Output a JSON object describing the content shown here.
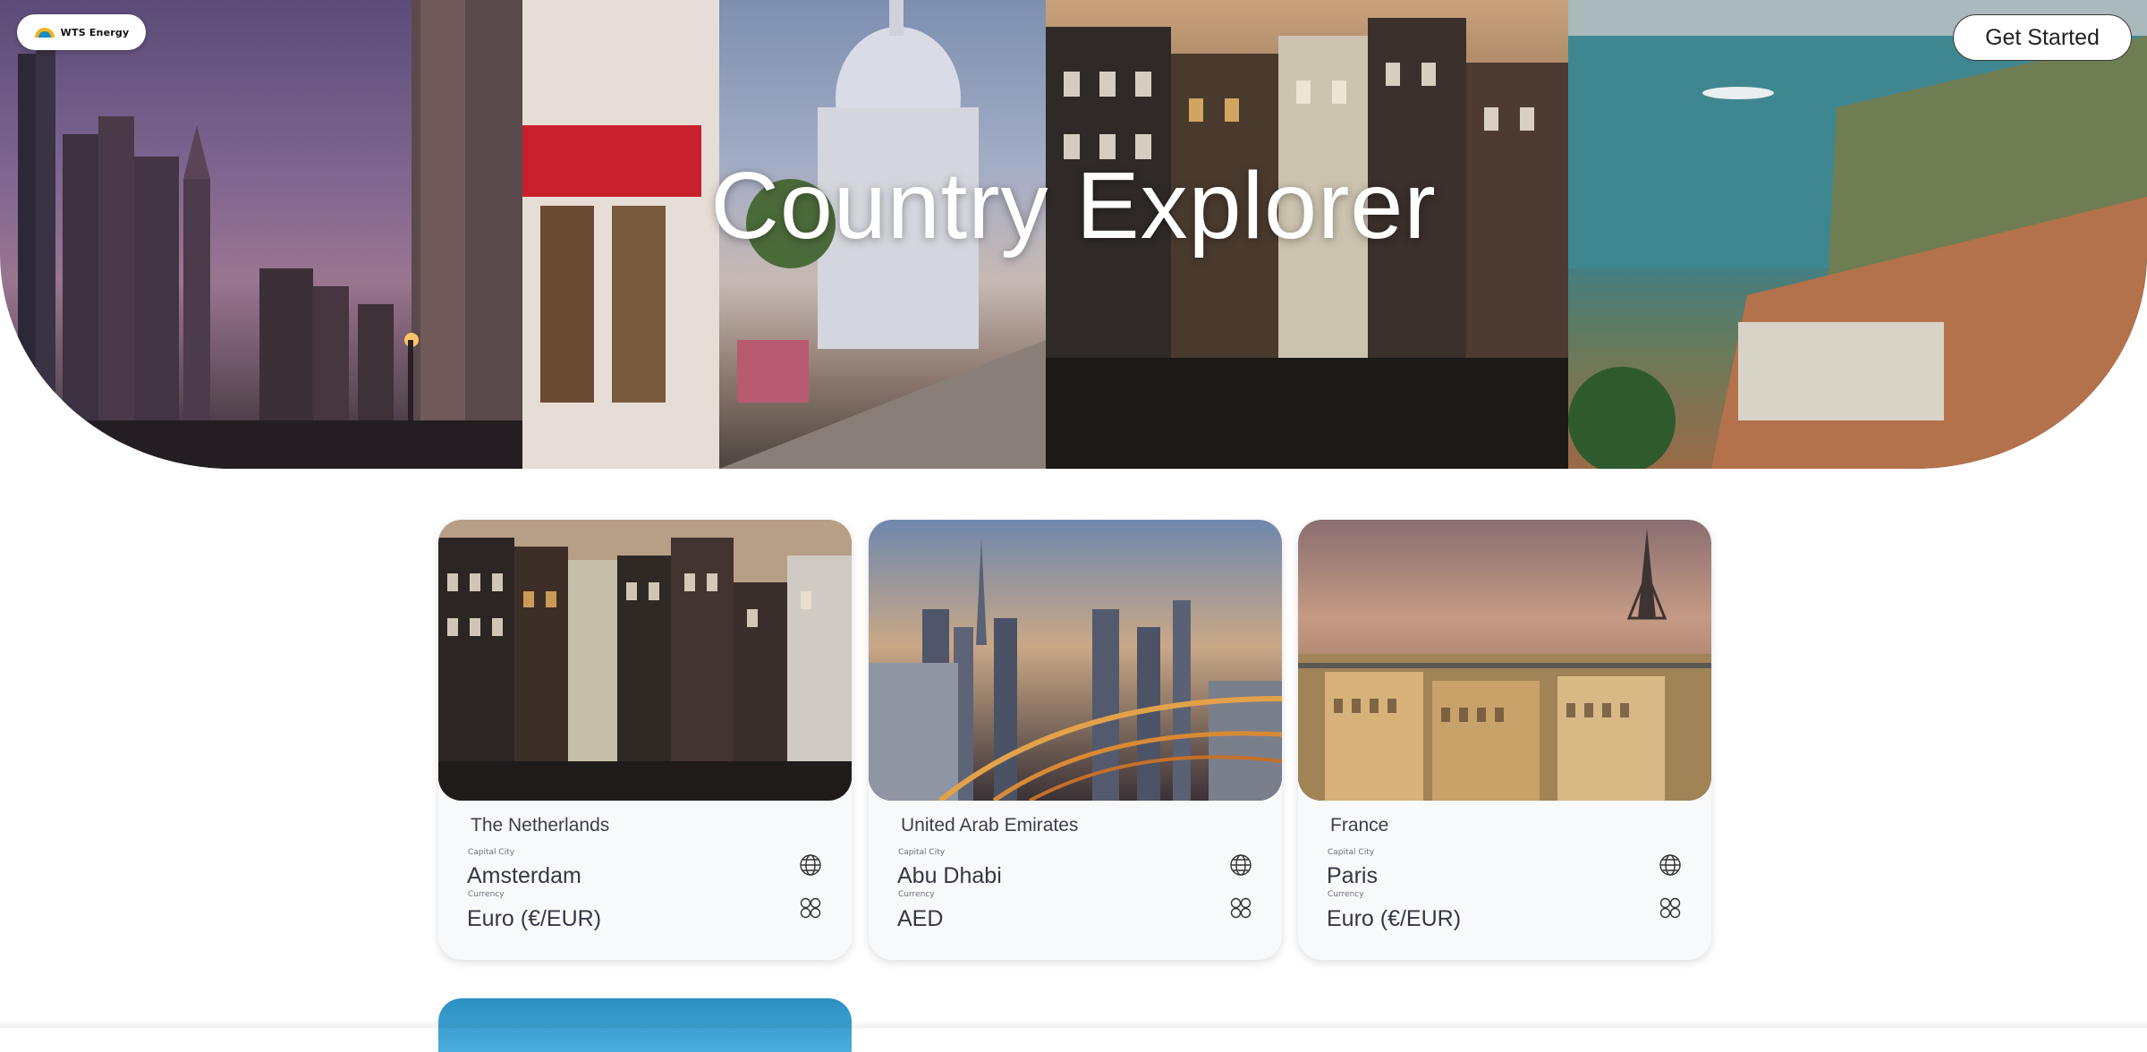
{
  "header": {
    "logo_text": "WTS Energy",
    "title": "Country Explorer",
    "cta_label": "Get Started"
  },
  "cards": [
    {
      "country": "The Netherlands",
      "capital_label": "Capital City",
      "capital": "Amsterdam",
      "currency_label": "Currency",
      "currency": "Euro (€/EUR)"
    },
    {
      "country": "United Arab Emirates",
      "capital_label": "Capital City",
      "capital": "Abu Dhabi",
      "currency_label": "Currency",
      "currency": "AED"
    },
    {
      "country": "France",
      "capital_label": "Capital City",
      "capital": "Paris",
      "currency_label": "Currency",
      "currency": "Euro (€/EUR)"
    }
  ],
  "icons": {
    "capital": "globe-icon",
    "currency": "currency-coins-icon"
  }
}
